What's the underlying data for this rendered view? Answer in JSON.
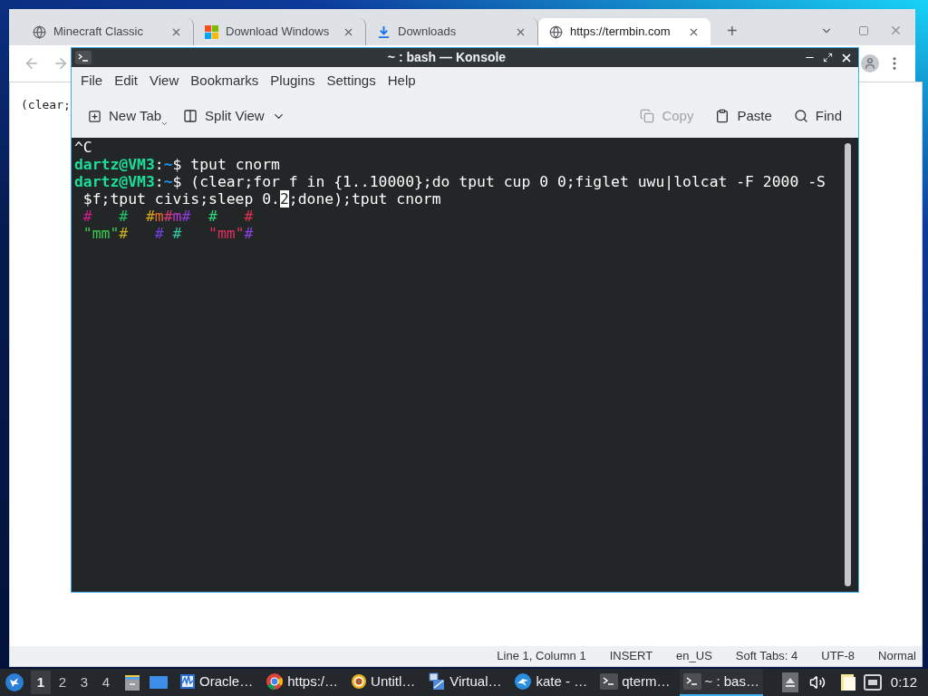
{
  "browser": {
    "tabs": [
      {
        "title": "Minecraft Classic",
        "kind": "globe",
        "selected": false
      },
      {
        "title": "Download Windows",
        "kind": "windows",
        "selected": false
      },
      {
        "title": "Downloads",
        "kind": "download",
        "selected": false
      },
      {
        "title": "https://termbin.com",
        "kind": "globe",
        "selected": true
      }
    ],
    "new_tab": "+"
  },
  "editor": {
    "text": "(clear;",
    "status_bar": [
      "Line 1, Column 1",
      "INSERT",
      "en_US",
      "Soft Tabs: 4",
      "UTF-8",
      "Normal"
    ]
  },
  "konsole": {
    "title": "~ : bash — Konsole",
    "menu": [
      "File",
      "Edit",
      "View",
      "Bookmarks",
      "Plugins",
      "Settings",
      "Help"
    ],
    "toolbar_left": [
      {
        "label": "New Tab",
        "kind": "new-tab",
        "disabled": false
      },
      {
        "label": "Split View",
        "kind": "split",
        "disabled": false
      }
    ],
    "toolbar_right": [
      {
        "label": "Copy",
        "kind": "copy",
        "disabled": true
      },
      {
        "label": "Paste",
        "kind": "paste",
        "disabled": false
      },
      {
        "label": "Find",
        "kind": "find",
        "disabled": false
      }
    ],
    "lines": [
      {
        "kind": "output",
        "text": "^C"
      },
      {
        "kind": "prompt",
        "user": "dartz@VM3",
        "separator": ":",
        "path": "~",
        "symbol": "$",
        "command": "tput cnorm"
      },
      {
        "kind": "prompt",
        "user": "dartz@VM3",
        "separator": ":",
        "path": "~",
        "symbol": "$",
        "command": "(clear;for f in {1..10000};do tput cup 0 0;figlet uwu|lolcat -F 2000 -S"
      },
      {
        "kind": "cursor",
        "before": " $f;tput civis;sleep 0.",
        "cursor": "2",
        "after": ";done);tput cnorm"
      },
      {
        "kind": "art",
        "segments": [
          {
            "text": " #",
            "color": "#d01c8b"
          },
          {
            "text": "   #",
            "color": "#1fc46c"
          },
          {
            "text": "  #",
            "color": "#d6a41c"
          },
          {
            "text": "m",
            "color": "#e0662a"
          },
          {
            "text": "#",
            "color": "#d83a7a"
          },
          {
            "text": "m",
            "color": "#b43ac9"
          },
          {
            "text": "#",
            "color": "#8a3ad8"
          },
          {
            "text": "  #",
            "color": "#2ed47a"
          },
          {
            "text": "   #",
            "color": "#e0304a"
          }
        ]
      },
      {
        "kind": "art",
        "segments": [
          {
            "text": " \"mm\"",
            "color": "#3cc850"
          },
          {
            "text": "#",
            "color": "#c8b020"
          },
          {
            "text": "   #",
            "color": "#7040e0"
          },
          {
            "text": " #",
            "color": "#30c8a0"
          },
          {
            "text": "   \"mm\"",
            "color": "#e03060"
          },
          {
            "text": "#",
            "color": "#9040e0"
          }
        ]
      }
    ]
  },
  "taskbar": {
    "workspaces": [
      {
        "label": "1",
        "selected": true
      },
      {
        "label": "2",
        "selected": false
      },
      {
        "label": "3",
        "selected": false
      },
      {
        "label": "4",
        "selected": false
      }
    ],
    "tasks": [
      {
        "label": "Oracle…",
        "kind": "monitor",
        "selected": false
      },
      {
        "label": "https:/…",
        "kind": "chrome",
        "selected": false
      },
      {
        "label": "Untitl…",
        "kind": "target",
        "selected": false
      },
      {
        "label": "Virtual…",
        "kind": "vm",
        "selected": false
      },
      {
        "label": "kate - …",
        "kind": "kate",
        "selected": false
      },
      {
        "label": "qterm…",
        "kind": "terminal",
        "selected": false
      },
      {
        "label": "~ : bas…",
        "kind": "terminal",
        "selected": true
      }
    ],
    "clock": "0:12"
  }
}
